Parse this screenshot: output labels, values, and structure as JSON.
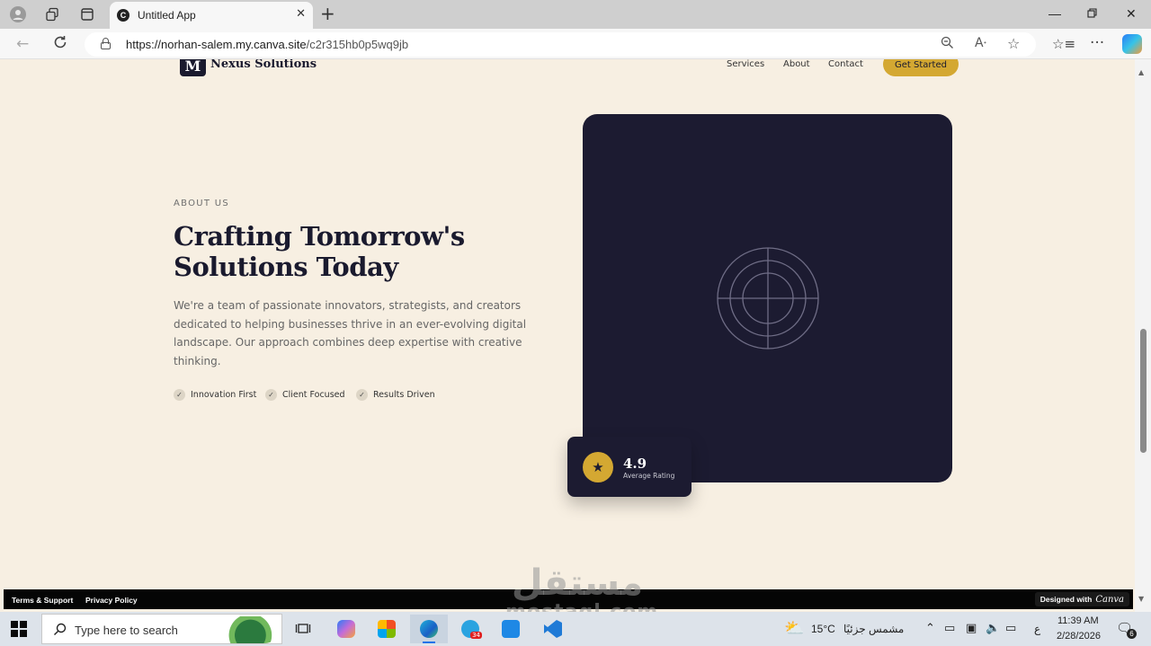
{
  "browser": {
    "tab_title": "Untitled App",
    "tab_favicon": "C",
    "url_host": "https://norhan-salem.my.canva.site",
    "url_path": "/c2r315hb0p5wq9jb",
    "icons": {
      "profile": "person-icon",
      "workspaces": "workspaces-icon",
      "tab_actions": "tab-actions-icon",
      "close_tab": "close-icon",
      "new_tab": "plus-icon",
      "back": "back-arrow-icon",
      "refresh": "refresh-icon",
      "lock": "lock-icon",
      "zoom": "zoom-icon",
      "read_aloud": "read-aloud-icon",
      "favorite": "star-icon",
      "favorites": "favorites-icon",
      "more": "more-icon",
      "copilot": "copilot-icon"
    }
  },
  "site": {
    "logo_letter": "M",
    "brand_name": "Nexus Solutions",
    "nav": [
      "Services",
      "About",
      "Contact"
    ],
    "cta_label": "Get Started",
    "eyebrow": "ABOUT US",
    "headline_line1": "Crafting Tomorrow's",
    "headline_line2": "Solutions Today",
    "body": "We're a team of passionate innovators, strategists, and creators dedicated to helping businesses thrive in an ever-evolving digital landscape. Our approach combines deep expertise with creative thinking.",
    "features": [
      "Innovation First",
      "Client Focused",
      "Results Driven"
    ],
    "rating_value": "4.9",
    "rating_label": "Average Rating",
    "footer_links": [
      "Terms & Support",
      "Privacy Policy"
    ],
    "designed_with": "Designed with",
    "designed_brand": "Canva",
    "colors": {
      "background": "#f7efe2",
      "dark": "#1c1b31",
      "accent": "#d4a832"
    }
  },
  "watermark": {
    "arabic": "مستقل",
    "latin": "mostaql.com"
  },
  "taskbar": {
    "search_placeholder": "Type here to search",
    "telegram_badge": "34",
    "weather_temp": "15°C",
    "weather_desc": "مشمس جزئيًا",
    "language": "ع",
    "time": "11:39 AM",
    "date": "2/28/2026",
    "notification_count": "6"
  }
}
